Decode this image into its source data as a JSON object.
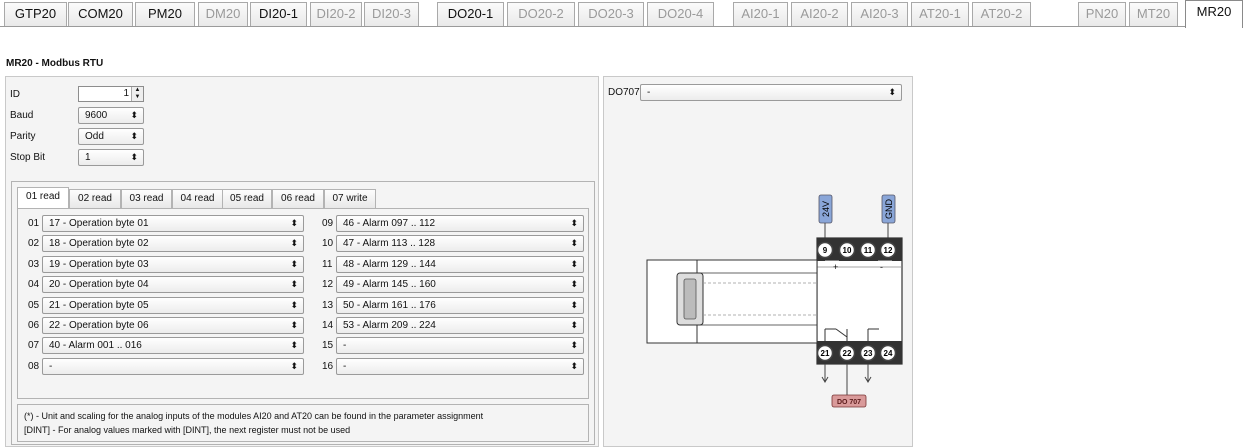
{
  "top_tabs": [
    {
      "label": "GTP20",
      "state": "normal"
    },
    {
      "label": "COM20",
      "state": "normal"
    },
    {
      "label": "PM20",
      "state": "normal"
    },
    {
      "label": "DM20",
      "state": "dim"
    },
    {
      "label": "DI20-1",
      "state": "normal"
    },
    {
      "label": "DI20-2",
      "state": "dim"
    },
    {
      "label": "DI20-3",
      "state": "dim"
    },
    {
      "label": "DO20-1",
      "state": "normal"
    },
    {
      "label": "DO20-2",
      "state": "dim"
    },
    {
      "label": "DO20-3",
      "state": "dim"
    },
    {
      "label": "DO20-4",
      "state": "dim"
    },
    {
      "label": "AI20-1",
      "state": "dim"
    },
    {
      "label": "AI20-2",
      "state": "dim"
    },
    {
      "label": "AI20-3",
      "state": "dim"
    },
    {
      "label": "AT20-1",
      "state": "dim"
    },
    {
      "label": "AT20-2",
      "state": "dim"
    },
    {
      "label": "PN20",
      "state": "dim"
    },
    {
      "label": "MT20",
      "state": "dim"
    },
    {
      "label": "MR20",
      "state": "active"
    }
  ],
  "page_title": "MR20 - Modbus RTU",
  "form": {
    "id_label": "ID",
    "id_value": "1",
    "baud_label": "Baud",
    "baud_value": "9600",
    "parity_label": "Parity",
    "parity_value": "Odd",
    "stopbit_label": "Stop Bit",
    "stopbit_value": "1"
  },
  "inner_tabs": [
    "01 read",
    "02 read",
    "03 read",
    "04 read",
    "05 read",
    "06 read",
    "07 write"
  ],
  "active_inner_tab": "01 read",
  "registers_left": [
    {
      "num": "01",
      "value": "17 - Operation byte 01"
    },
    {
      "num": "02",
      "value": "18 - Operation byte 02"
    },
    {
      "num": "03",
      "value": "19 - Operation byte 03"
    },
    {
      "num": "04",
      "value": "20 - Operation byte 04"
    },
    {
      "num": "05",
      "value": "21 - Operation byte 05"
    },
    {
      "num": "06",
      "value": "22 - Operation byte 06"
    },
    {
      "num": "07",
      "value": "40 - Alarm 001 .. 016"
    },
    {
      "num": "08",
      "value": "-"
    }
  ],
  "registers_right": [
    {
      "num": "09",
      "value": "46 - Alarm 097 .. 112"
    },
    {
      "num": "10",
      "value": "47 - Alarm 113 .. 128"
    },
    {
      "num": "11",
      "value": "48 - Alarm 129 .. 144"
    },
    {
      "num": "12",
      "value": "49 - Alarm 145 .. 160"
    },
    {
      "num": "13",
      "value": "50 - Alarm 161 .. 176"
    },
    {
      "num": "14",
      "value": "53 - Alarm 209 .. 224"
    },
    {
      "num": "15",
      "value": "-"
    },
    {
      "num": "16",
      "value": "-"
    }
  ],
  "notes": {
    "line1": "(*) - Unit and scaling for the analog inputs of the modules AI20 and AT20 can be found in the parameter assignment",
    "line2": "[DINT] - For analog values marked with [DINT], the next register must not be used"
  },
  "right_panel": {
    "select_label": "DO707",
    "select_value": "-"
  },
  "diagram": {
    "power_labels": {
      "v24": "24V",
      "gnd": "GND"
    },
    "top_terminals": [
      "9",
      "10",
      "11",
      "12"
    ],
    "bottom_terminals": [
      "21",
      "22",
      "23",
      "24"
    ],
    "plus_sign": "+",
    "minus_sign": "-",
    "output_label": "DO 707",
    "colors": {
      "power_tag": "#8aa6d8",
      "output_tag": "#d99a9a",
      "terminal": "#444444"
    }
  }
}
